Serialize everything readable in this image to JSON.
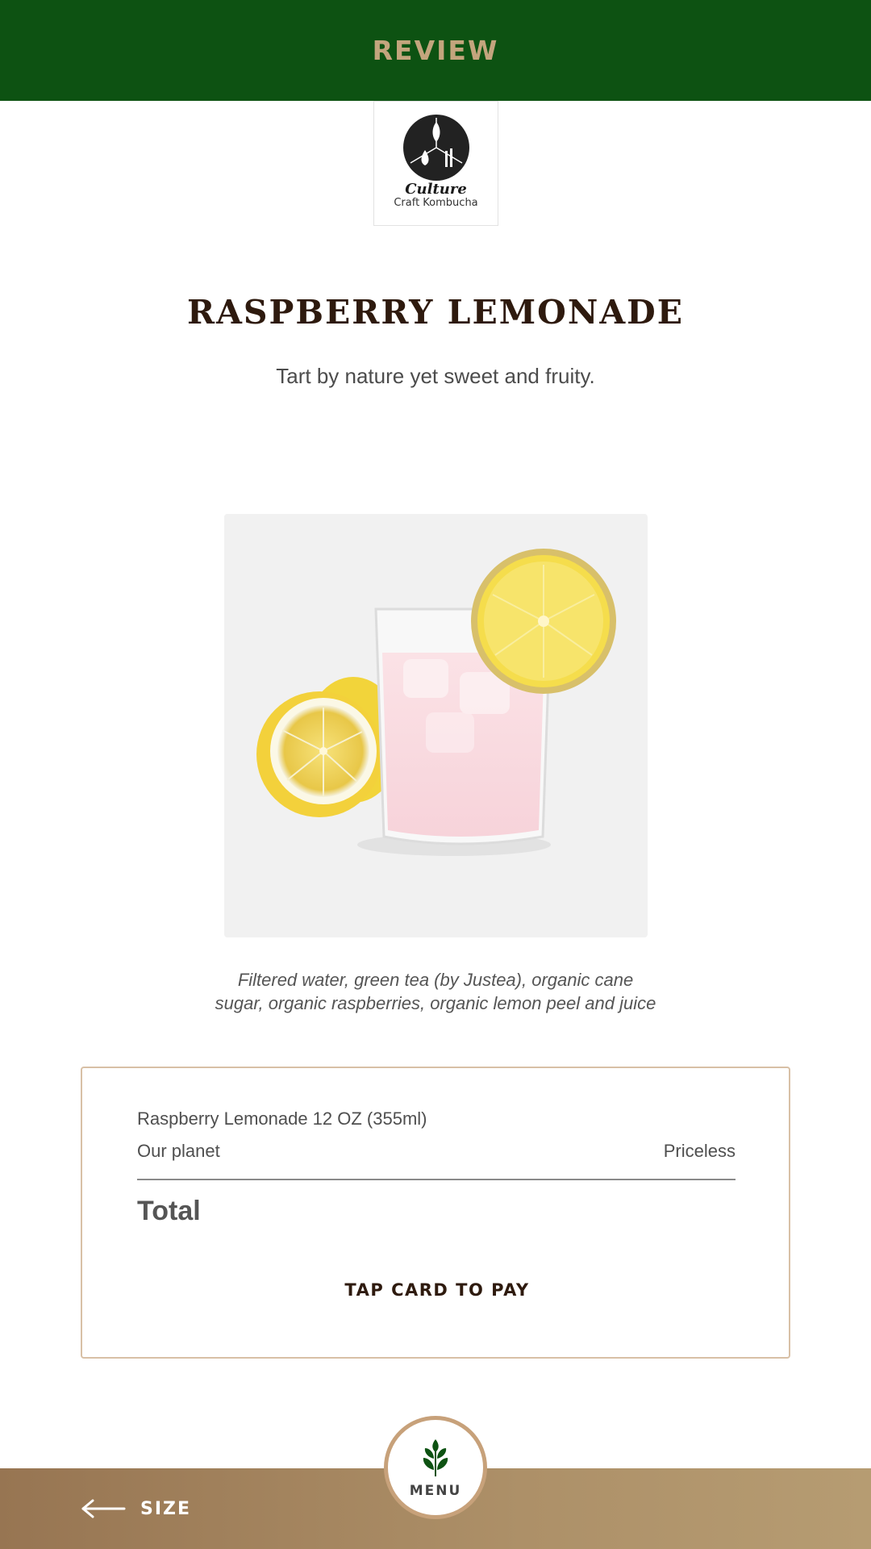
{
  "header": {
    "title": "REVIEW"
  },
  "brand": {
    "logo_name": "Culture",
    "logo_subtitle": "Craft Kombucha",
    "logo_icon": "wheat-drop-cane-logo"
  },
  "product": {
    "name": "RASPBERRY LEMONADE",
    "tagline": "Tart by nature yet sweet and fruity.",
    "image_icon": "raspberry-lemonade-glass-photo",
    "ingredients": "Filtered water, green tea (by Justea), organic cane sugar, organic raspberries, organic lemon peel and juice"
  },
  "order": {
    "item_name": "Raspberry Lemonade 12 OZ (355ml)",
    "line_label": "Our planet",
    "line_value": "Priceless",
    "total_label": "Total",
    "pay_label": "TAP CARD TO PAY"
  },
  "footer": {
    "back_label": "SIZE",
    "back_icon": "arrow-left-icon",
    "menu_label": "MENU",
    "menu_icon": "leaf-icon"
  },
  "colors": {
    "header_bg": "#0d5212",
    "accent_gold": "#c3a57d",
    "title_brown": "#2e1a0e",
    "card_border": "#d8c0a6",
    "footer_bg": "#a88a63"
  }
}
